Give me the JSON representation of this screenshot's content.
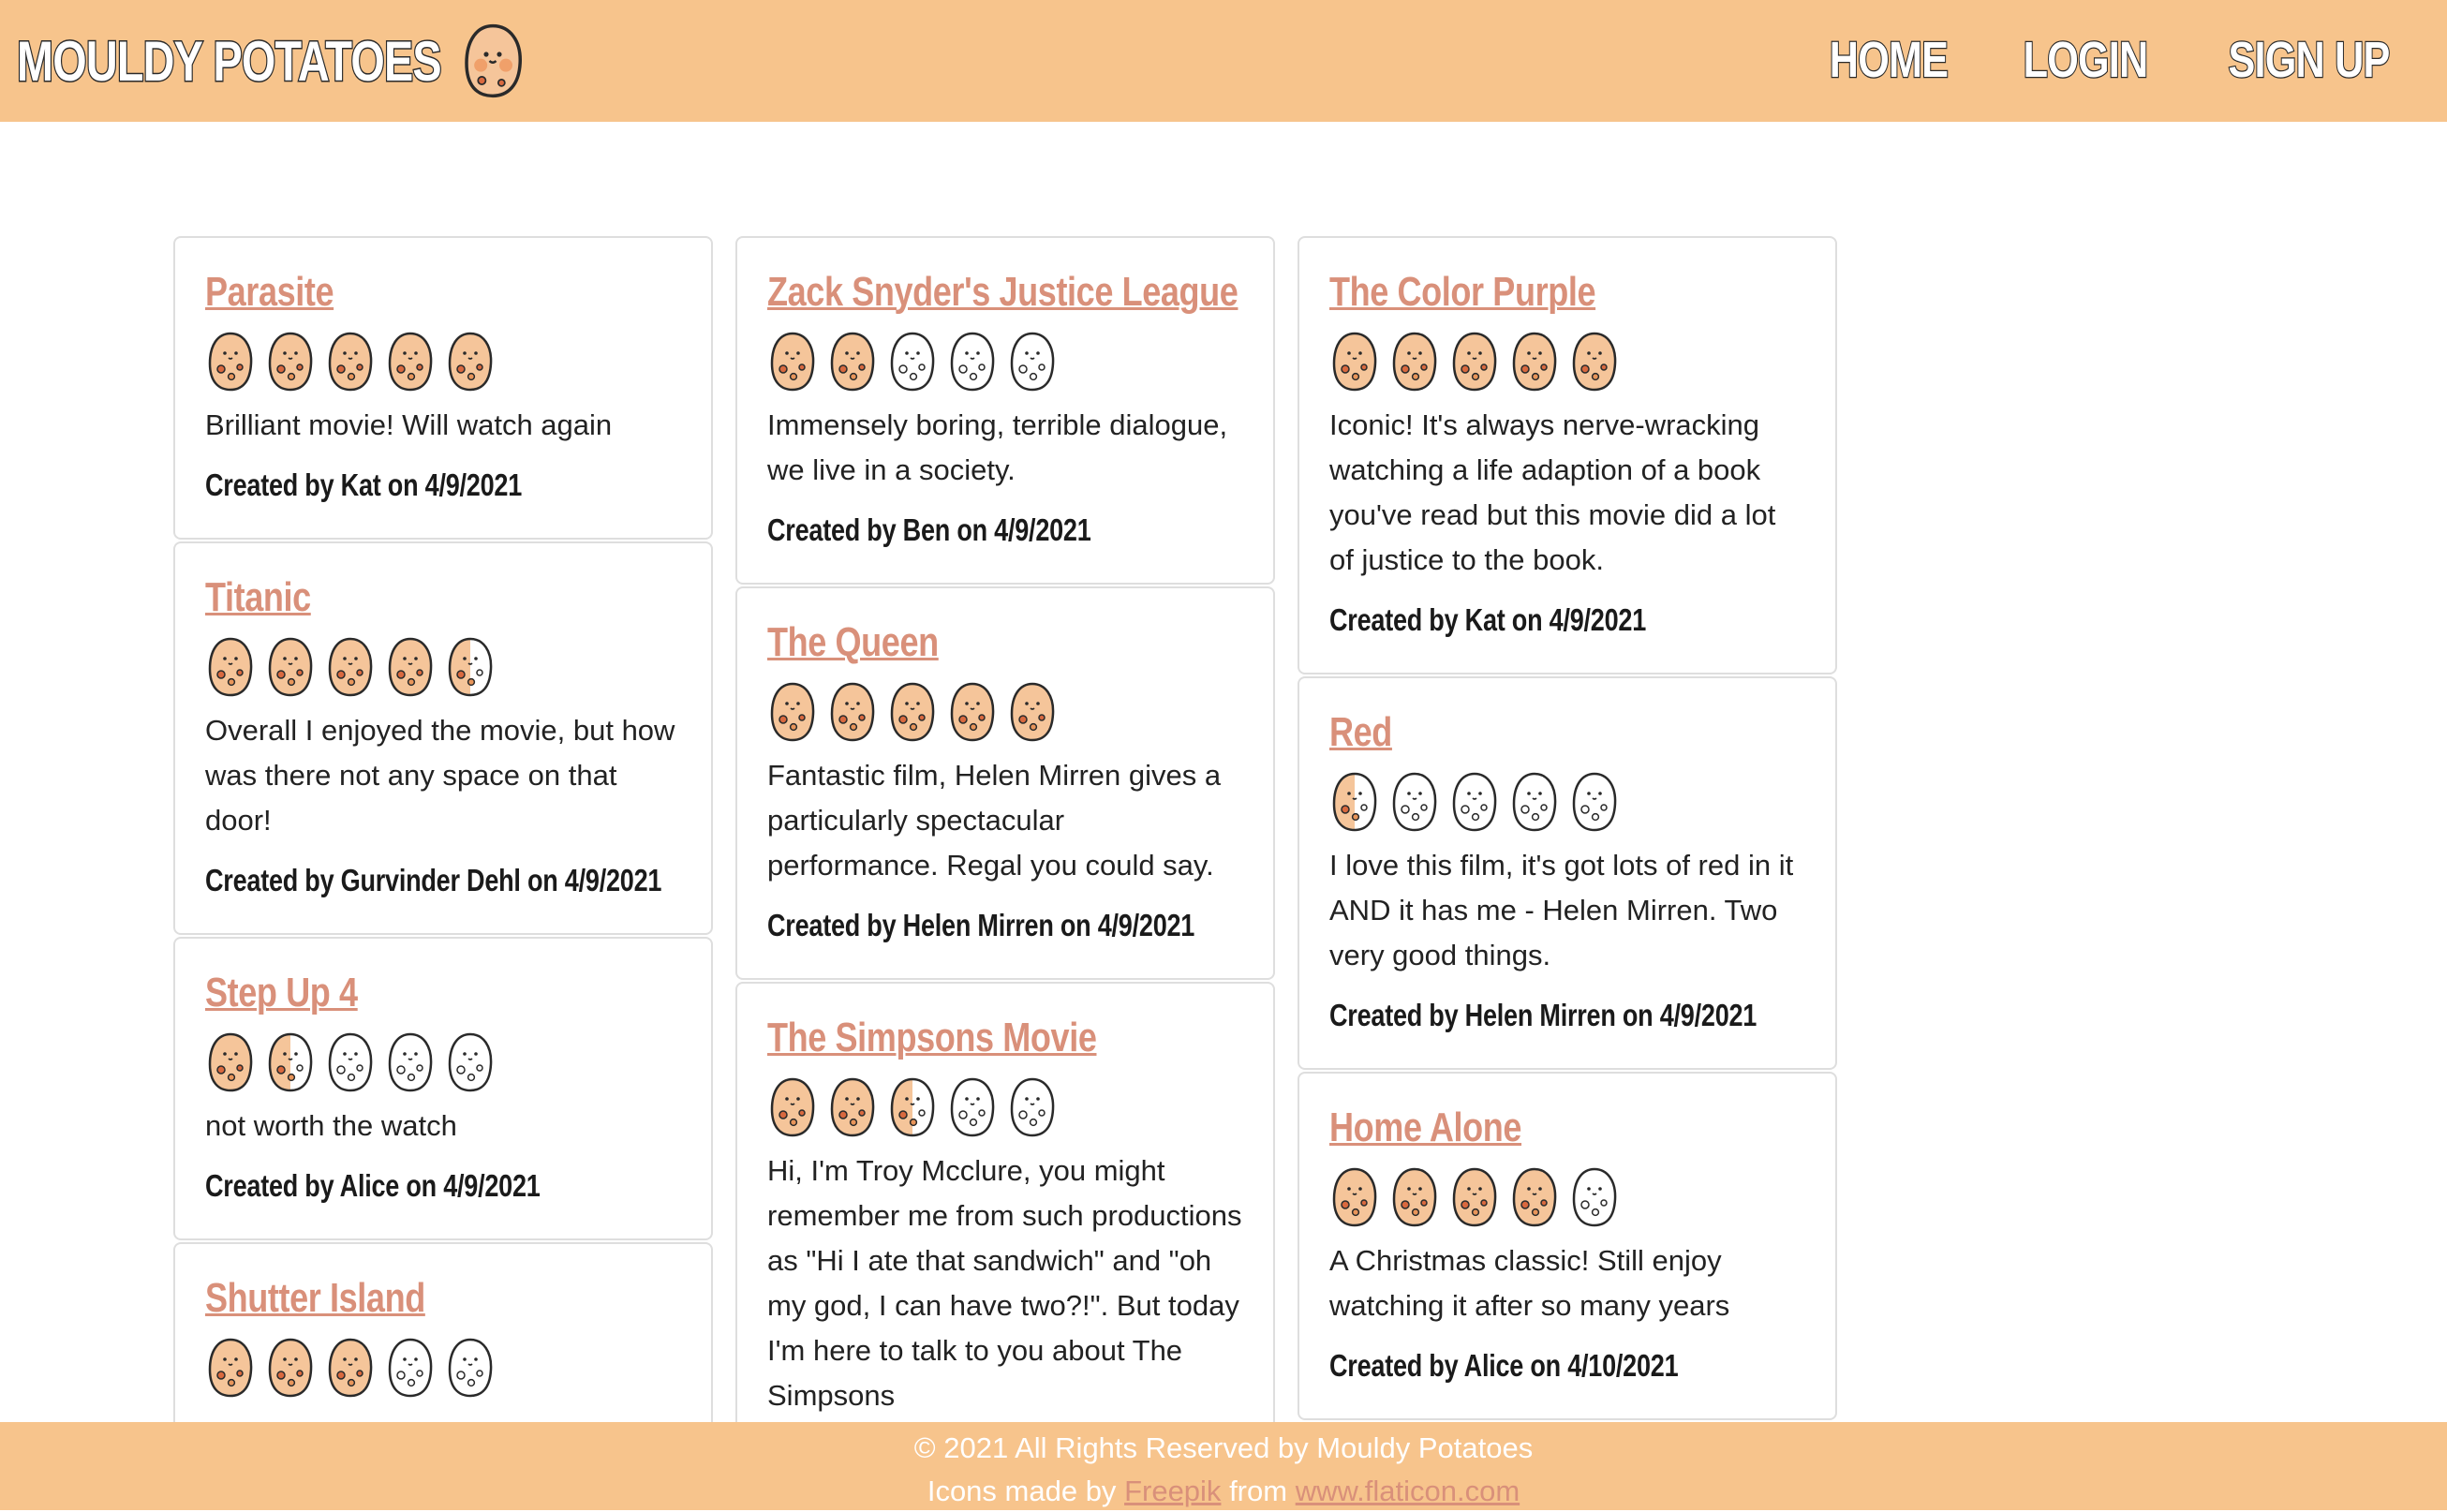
{
  "header": {
    "brand": "MOULDY POTATOES",
    "nav": [
      "HOME",
      "LOGIN",
      "SIGN UP"
    ]
  },
  "colors": {
    "header_bg": "#f7c48c",
    "link": "#d9907a",
    "potato_fill": "#f5c59a",
    "spot": "#d9693f"
  },
  "icons": {
    "rating": "potato-icon",
    "logo": "potato-icon"
  },
  "columns": [
    [
      {
        "title": "Parasite",
        "rating": 5,
        "review": "Brilliant movie! Will watch again",
        "meta": "Created by Kat on 4/9/2021"
      },
      {
        "title": "Titanic",
        "rating": 4.5,
        "review": "Overall I enjoyed the movie, but how was there not any space on that door!",
        "meta": "Created by Gurvinder Dehl on 4/9/2021"
      },
      {
        "title": "Step Up 4",
        "rating": 1.5,
        "review": "not worth the watch",
        "meta": "Created by Alice on 4/9/2021"
      },
      {
        "title": "Shutter Island",
        "rating": 3,
        "review": "",
        "meta": ""
      }
    ],
    [
      {
        "title": "Zack Snyder's Justice League",
        "rating": 2,
        "review": "Immensely boring, terrible dialogue, we live in a society.",
        "meta": "Created by Ben on 4/9/2021"
      },
      {
        "title": "The Queen",
        "rating": 5,
        "review": "Fantastic film, Helen Mirren gives a particularly spectacular performance. Regal you could say.",
        "meta": "Created by Helen Mirren on 4/9/2021"
      },
      {
        "title": "The Simpsons Movie",
        "rating": 2.5,
        "review": "Hi, I'm Troy Mcclure, you might remember me from such productions as \"Hi I ate that sandwich\" and \"oh my god, I can have two?!\". But today I'm here to talk to you about The Simpsons",
        "meta": ""
      }
    ],
    [
      {
        "title": "The Color Purple",
        "rating": 5,
        "review": "Iconic! It's always nerve-wracking watching a life adaption of a book you've read but this movie did a lot of justice to the book.",
        "meta": "Created by Kat on 4/9/2021"
      },
      {
        "title": "Red",
        "rating": 0.5,
        "review": "I love this film, it's got lots of red in it AND it has me - Helen Mirren. Two very good things.",
        "meta": "Created by Helen Mirren on 4/9/2021"
      },
      {
        "title": "Home Alone",
        "rating": 4,
        "review": "A Christmas classic! Still enjoy watching it after so many years",
        "meta": "Created by Alice on 4/10/2021"
      }
    ]
  ],
  "footer": {
    "copyright": "© 2021 All Rights Reserved by Mouldy Potatoes",
    "credit_prefix": "Icons made by",
    "credit_author": "Freepik",
    "credit_mid": "from",
    "credit_site": "www.flaticon.com"
  }
}
